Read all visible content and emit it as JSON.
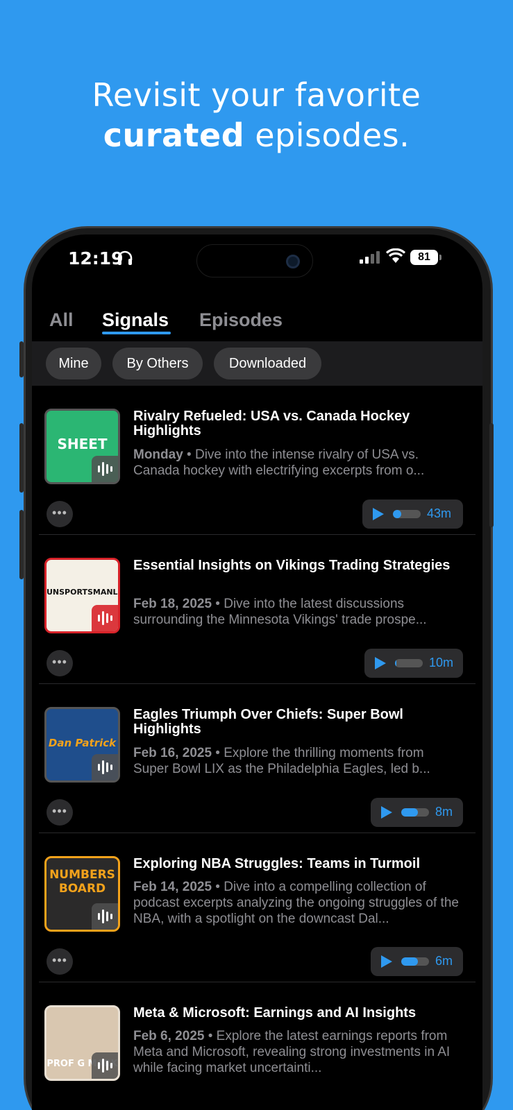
{
  "headline": {
    "line1": "Revisit your favorite",
    "line2_bold": "curated",
    "line2_rest": " episodes."
  },
  "status_bar": {
    "time": "12:19",
    "battery": "81"
  },
  "tabs": [
    {
      "label": "All",
      "active": false
    },
    {
      "label": "Signals",
      "active": true
    },
    {
      "label": "Episodes",
      "active": false
    }
  ],
  "filters": [
    "Mine",
    "By Others",
    "Downloaded"
  ],
  "more_label": "•••",
  "episodes": [
    {
      "title": "Rivalry Refueled: USA vs. Canada Hockey Highlights",
      "date": "Monday",
      "description": " • Dive into the intense rivalry of USA vs. Canada hockey with electrifying excerpts from o...",
      "duration": "43m",
      "progress": 0.3,
      "art_text": "SHEET",
      "art_color": "#2bb673"
    },
    {
      "title": "Essential Insights on Vikings Trading Strategies",
      "date": "Feb 18, 2025",
      "description": " • Dive into the latest discussions surrounding the Minnesota Vikings' trade prospe...",
      "duration": "10m",
      "progress": 0.05,
      "art_text": "UNSPORTSMANLIKE",
      "art_color": "#f4f0e6"
    },
    {
      "title": "Eagles Triumph Over Chiefs: Super Bowl Highlights",
      "date": "Feb 16, 2025",
      "description": " • Explore the thrilling moments from Super Bowl LIX as the Philadelphia Eagles, led b...",
      "duration": "8m",
      "progress": 0.6,
      "art_text": "Dan Patrick",
      "art_color": "#1f4e8c"
    },
    {
      "title": "Exploring NBA Struggles: Teams in Turmoil",
      "date": "Feb 14, 2025",
      "description": " • Dive into a compelling collection of podcast excerpts analyzing the ongoing struggles of the NBA, with a spotlight on the downcast Dal...",
      "duration": "6m",
      "progress": 0.6,
      "art_text": "NUMBERS BOARD",
      "art_color": "#2b2a2a"
    },
    {
      "title": "Meta & Microsoft: Earnings and AI Insights",
      "date": "Feb 6, 2025",
      "description": " • Explore the latest earnings reports from Meta and Microsoft, revealing strong investments in AI while facing market uncertainti...",
      "duration": "",
      "progress": 0,
      "art_text": "PROF G MARK",
      "art_color": "#d9c7b0"
    }
  ]
}
